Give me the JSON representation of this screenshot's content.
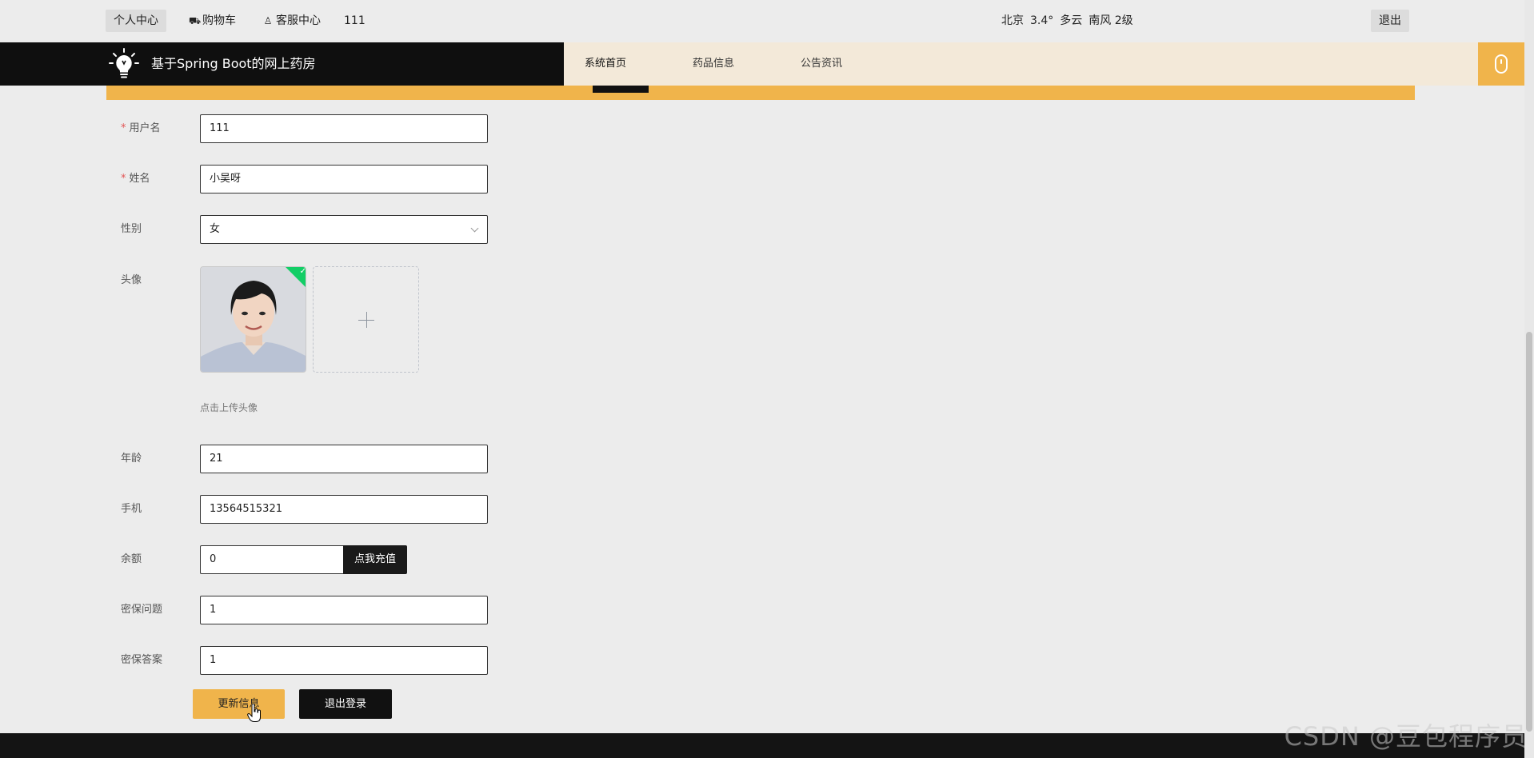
{
  "topbar": {
    "personal_center": "个人中心",
    "cart": "购物车",
    "service": "客服中心",
    "user_id": "111",
    "weather": {
      "city": "北京",
      "temp": "3.4°",
      "condition": "多云",
      "wind": "南风 2级"
    },
    "logout": "退出"
  },
  "header": {
    "title": "基于Spring Boot的网上药房",
    "nav": {
      "home": "系统首页",
      "medicine": "药品信息",
      "news": "公告资讯"
    }
  },
  "form": {
    "username": {
      "label": "用户名",
      "value": "111"
    },
    "name": {
      "label": "姓名",
      "value": "小吴呀"
    },
    "gender": {
      "label": "性别",
      "value": "女"
    },
    "avatar": {
      "label": "头像",
      "tip": "点击上传头像"
    },
    "age": {
      "label": "年龄",
      "value": "21"
    },
    "phone": {
      "label": "手机",
      "value": "13564515321"
    },
    "balance": {
      "label": "余额",
      "value": "0",
      "recharge": "点我充值"
    },
    "security_question": {
      "label": "密保问题",
      "value": "1"
    },
    "security_answer": {
      "label": "密保答案",
      "value": "1"
    }
  },
  "actions": {
    "update": "更新信息",
    "logout": "退出登录"
  },
  "watermark": "CSDN @豆包程序员",
  "colors": {
    "accent": "#f0b44b",
    "dark": "#0f0f0f",
    "nav_bg": "#f3e9d9",
    "success": "#13ce66"
  }
}
